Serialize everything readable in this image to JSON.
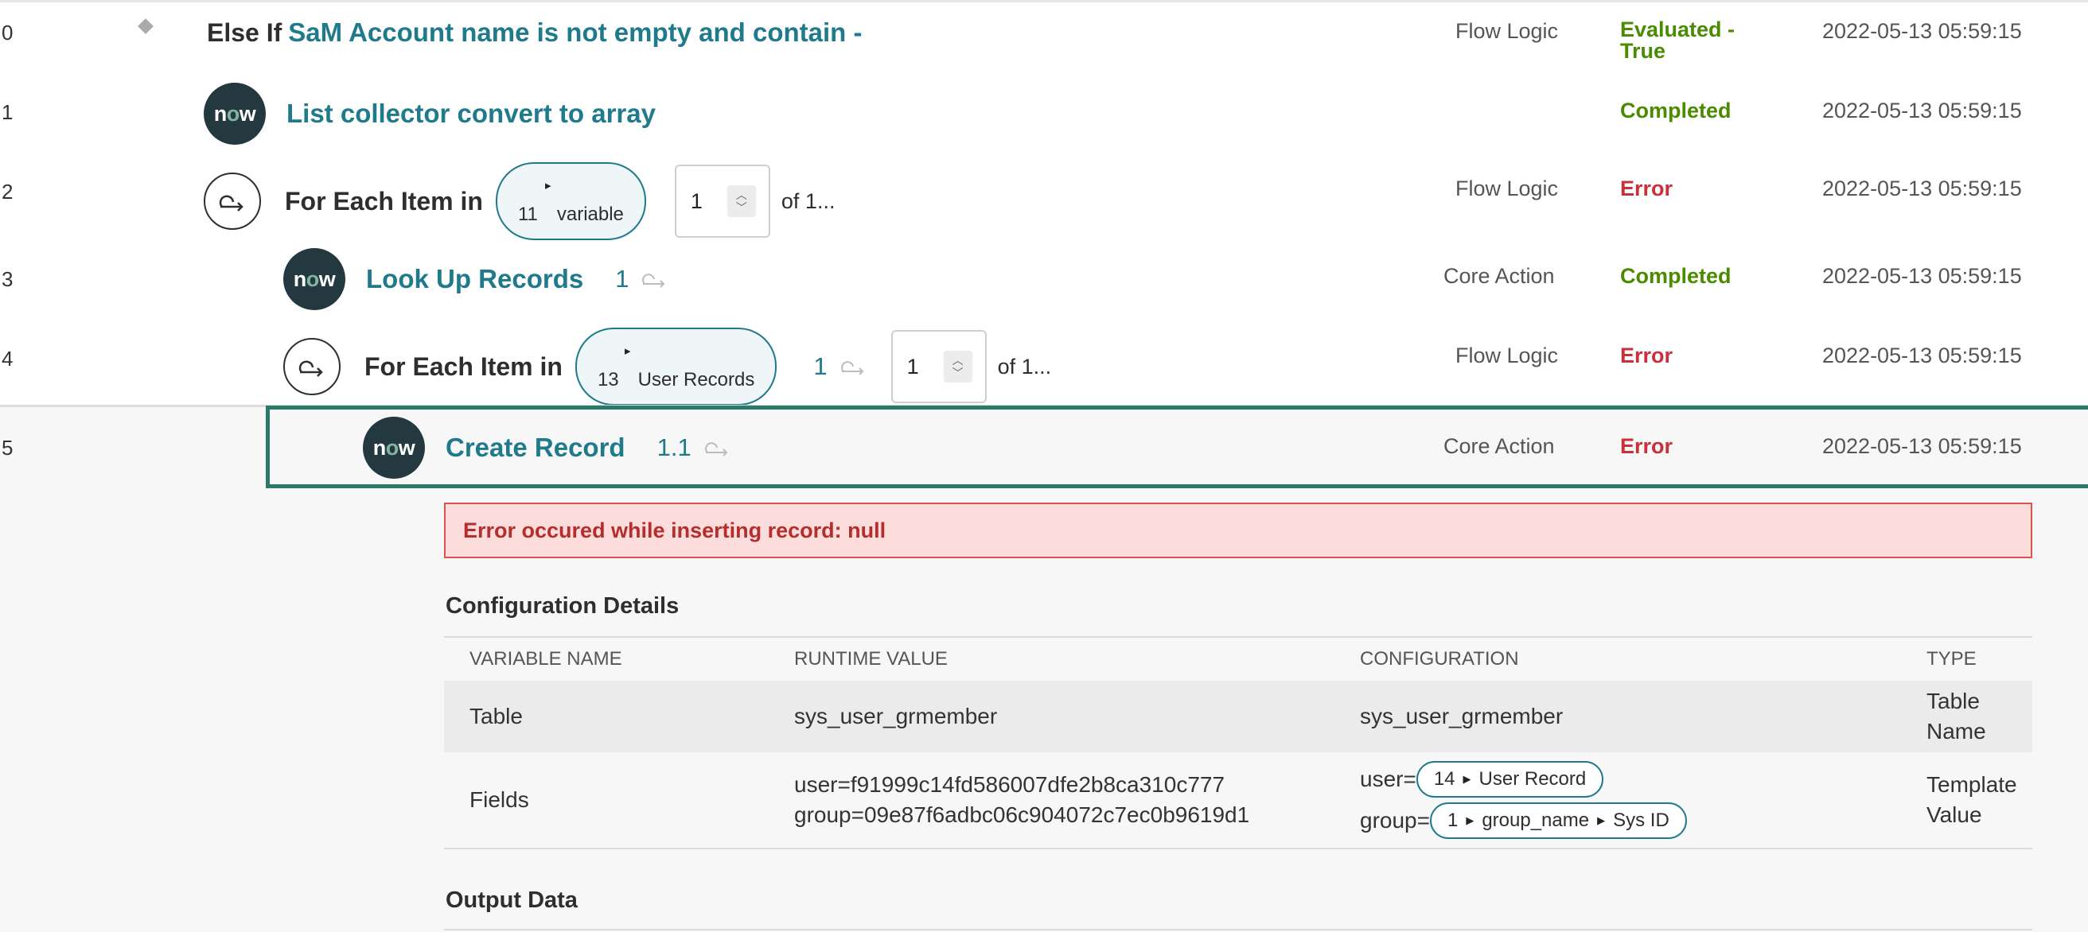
{
  "rows": [
    {
      "num": "0",
      "prefix": "Else If",
      "title": "SaM Account name is not empty and contain -",
      "type": "Flow Logic",
      "status_line1": "Evaluated -",
      "status_line2": "True",
      "time": "2022-05-13 05:59:15"
    },
    {
      "num": "1",
      "title": "List collector convert to array",
      "type": "",
      "status": "Completed",
      "time": "2022-05-13 05:59:15"
    },
    {
      "num": "2",
      "label": "For Each Item in",
      "pill_count": "11",
      "pill_label": "variable",
      "stepper_value": "1",
      "of_text": "of 1...",
      "type": "Flow Logic",
      "status": "Error",
      "time": "2022-05-13 05:59:15"
    },
    {
      "num": "3",
      "title": "Look Up Records",
      "iteration": "1",
      "type": "Core Action",
      "status": "Completed",
      "time": "2022-05-13 05:59:15"
    },
    {
      "num": "4",
      "label": "For Each Item in",
      "pill_count": "13",
      "pill_label": "User Records",
      "iteration": "1",
      "stepper_value": "1",
      "of_text": "of 1...",
      "type": "Flow Logic",
      "status": "Error",
      "time": "2022-05-13 05:59:15"
    },
    {
      "num": "5",
      "title": "Create Record",
      "iteration": "1.1",
      "type": "Core Action",
      "status": "Error",
      "time": "2022-05-13 05:59:15"
    }
  ],
  "logo_text": {
    "n": "n",
    "o": "o",
    "w": "w"
  },
  "error_message": "Error occured while inserting record: null",
  "config": {
    "title": "Configuration Details",
    "headers": [
      "VARIABLE NAME",
      "RUNTIME VALUE",
      "CONFIGURATION",
      "TYPE"
    ],
    "table_row": {
      "name": "Table",
      "runtime": "sys_user_grmember",
      "configuration": "sys_user_grmember",
      "type_line1": "Table",
      "type_line2": "Name"
    },
    "fields_row": {
      "name": "Fields",
      "runtime_line1": "user=f91999c14fd586007dfe2b8ca310c777",
      "runtime_line2": "group=09e87f6adbc06c904072c7ec0b9619d1",
      "config_user_prefix": "user=",
      "config_user_pill": [
        "14",
        "User Record"
      ],
      "config_group_prefix": "group=",
      "config_group_pill": [
        "1",
        "group_name",
        "Sys ID"
      ],
      "type_line1": "Template",
      "type_line2": "Value"
    }
  },
  "output_title": "Output Data",
  "colors": {
    "teal": "#1f7a8c",
    "green": "#4a8b00",
    "red": "#c8313b",
    "logo_bg": "#23393f",
    "selected_border": "#2a7a6a"
  }
}
